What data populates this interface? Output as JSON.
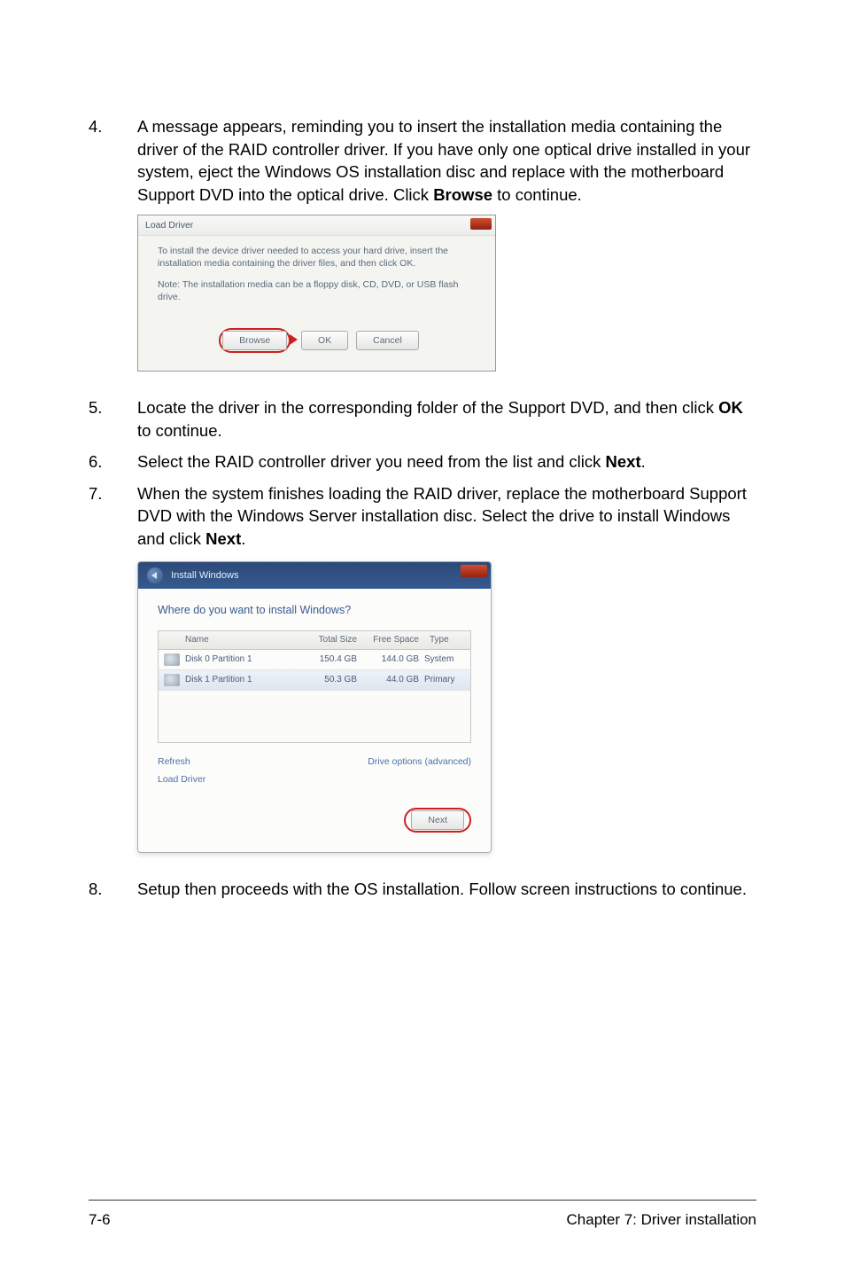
{
  "steps": {
    "s4": {
      "num": "4.",
      "text_a": "A message appears, reminding you to insert the installation media containing the driver of the RAID controller driver. If you have only one optical drive installed in your system, eject the Windows OS installation disc and replace with the motherboard Support DVD into the optical drive. Click ",
      "bold1": "Browse",
      "text_b": " to continue."
    },
    "s5": {
      "num": "5.",
      "text_a": "Locate the driver in the corresponding folder of the Support DVD, and then click ",
      "bold1": "OK",
      "text_b": " to continue."
    },
    "s6": {
      "num": "6.",
      "text_a": "Select the RAID controller driver you need from the list and click ",
      "bold1": "Next",
      "text_b": "."
    },
    "s7": {
      "num": "7.",
      "text_a": "When the system finishes loading the RAID driver, replace the motherboard Support DVD with the Windows Server installation disc. Select the drive to install Windows and click ",
      "bold1": "Next",
      "text_b": "."
    },
    "s8": {
      "num": "8.",
      "text_a": "Setup then proceeds with the OS installation. Follow screen instructions to continue."
    }
  },
  "dialog1": {
    "title": "Load Driver",
    "msg": "To install the device driver needed to access your hard drive, insert the installation media containing the driver files, and then click OK.",
    "note": "Note: The installation media can be a floppy disk, CD, DVD, or USB flash drive.",
    "browse": "Browse",
    "ok": "OK",
    "cancel": "Cancel"
  },
  "dialog2": {
    "header": "Install Windows",
    "question": "Where do you want to install Windows?",
    "col_name": "Name",
    "col_ts": "Total Size",
    "col_fs": "Free Space",
    "col_tp": "Type",
    "rows": [
      {
        "name": "Disk 0 Partition 1",
        "ts": "150.4 GB",
        "fs": "144.0 GB",
        "tp": "System"
      },
      {
        "name": "Disk 1 Partition 1",
        "ts": "50.3 GB",
        "fs": "44.0 GB",
        "tp": "Primary"
      }
    ],
    "refresh": "Refresh",
    "advanced": "Drive options (advanced)",
    "load": "Load Driver",
    "next": "Next"
  },
  "footer": {
    "left": "7-6",
    "right": "Chapter 7: Driver installation"
  }
}
